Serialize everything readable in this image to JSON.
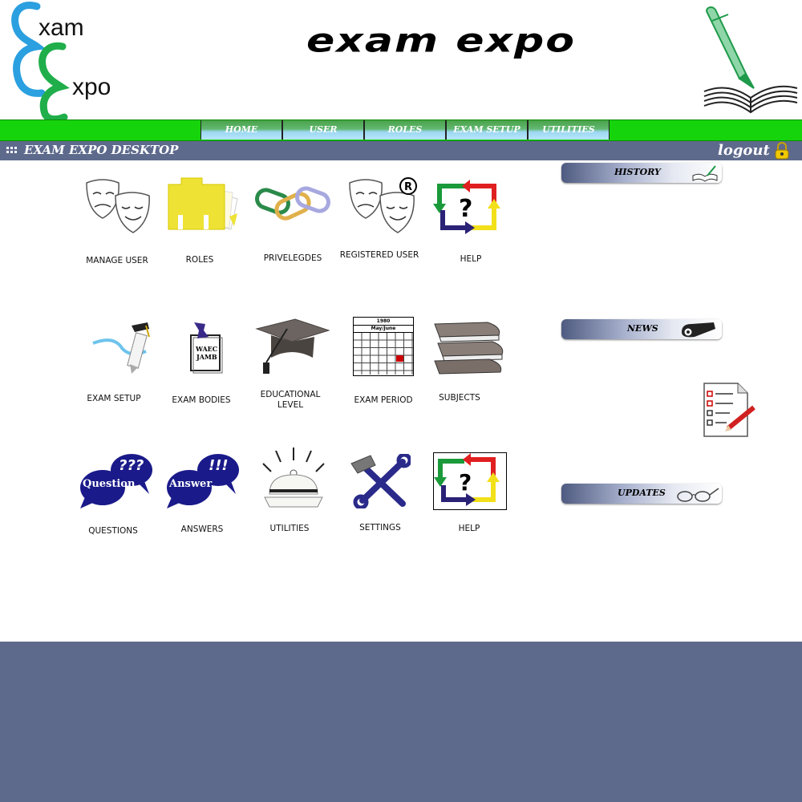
{
  "logo": {
    "line1": "xam",
    "line2": "xpo"
  },
  "header": {
    "title": "exam expo"
  },
  "nav": {
    "tabs": [
      "HOME",
      "USER",
      "ROLES",
      "EXAM SETUP",
      "UTILITIES"
    ]
  },
  "desktop": {
    "title": "EXAM EXPO DESKTOP",
    "logout": "logout"
  },
  "icons": {
    "row1": [
      "MANAGE USER",
      "ROLES",
      "PRIVELEGDES",
      "REGISTERED USER",
      "HELP"
    ],
    "row2": [
      "EXAM SETUP",
      "EXAM BODIES",
      "EDUCATIONAL LEVEL",
      "EXAM PERIOD",
      "SUBJECTS"
    ],
    "row3": [
      "QUESTIONS",
      "ANSWERS",
      "UTILITIES",
      "SETTINGS",
      "HELP"
    ]
  },
  "bodies_doc": {
    "line1": "WAEC",
    "line2": "JAMB"
  },
  "calendar": {
    "year": "1980",
    "month": "May/June",
    "days": [
      "S",
      "M",
      "T",
      "W",
      "T",
      "F",
      "S"
    ]
  },
  "bubbles": {
    "question": "Question",
    "question_marks": "???",
    "answer": "Answer",
    "answer_marks": "!!!"
  },
  "panels": {
    "history": "HISTORY",
    "news": "NEWS",
    "updates": "UPDATES"
  },
  "colors": {
    "nav_green": "#16d40b",
    "bar_blue": "#5e6a8c",
    "help_green": "#1a9a3a",
    "help_red": "#e02020",
    "help_yellow": "#f2e01a",
    "help_navy": "#2a2277"
  }
}
